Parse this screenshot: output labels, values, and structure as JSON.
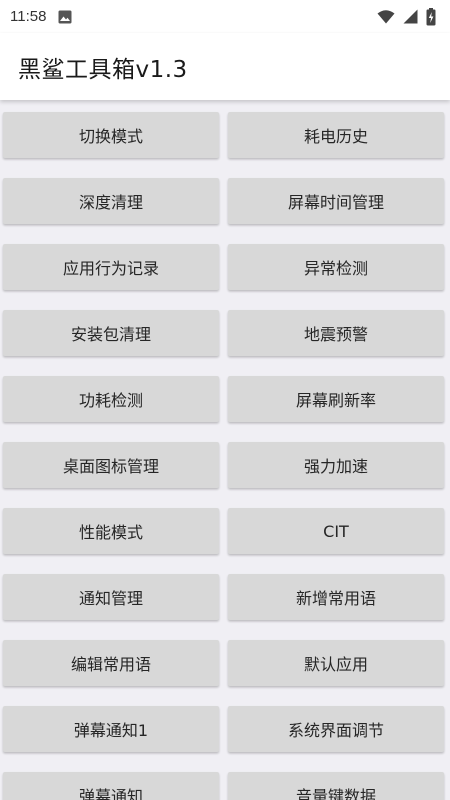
{
  "status": {
    "time": "11:58"
  },
  "app": {
    "title": "黑鲨工具箱v1.3"
  },
  "buttons": [
    "切换模式",
    "耗电历史",
    "深度清理",
    "屏幕时间管理",
    "应用行为记录",
    "异常检测",
    "安装包清理",
    "地震预警",
    "功耗检测",
    "屏幕刷新率",
    "桌面图标管理",
    "强力加速",
    "性能模式",
    "CIT",
    "通知管理",
    "新增常用语",
    "编辑常用语",
    "默认应用",
    "弹幕通知1",
    "系统界面调节",
    "弹幕通知",
    "音量键数据"
  ]
}
